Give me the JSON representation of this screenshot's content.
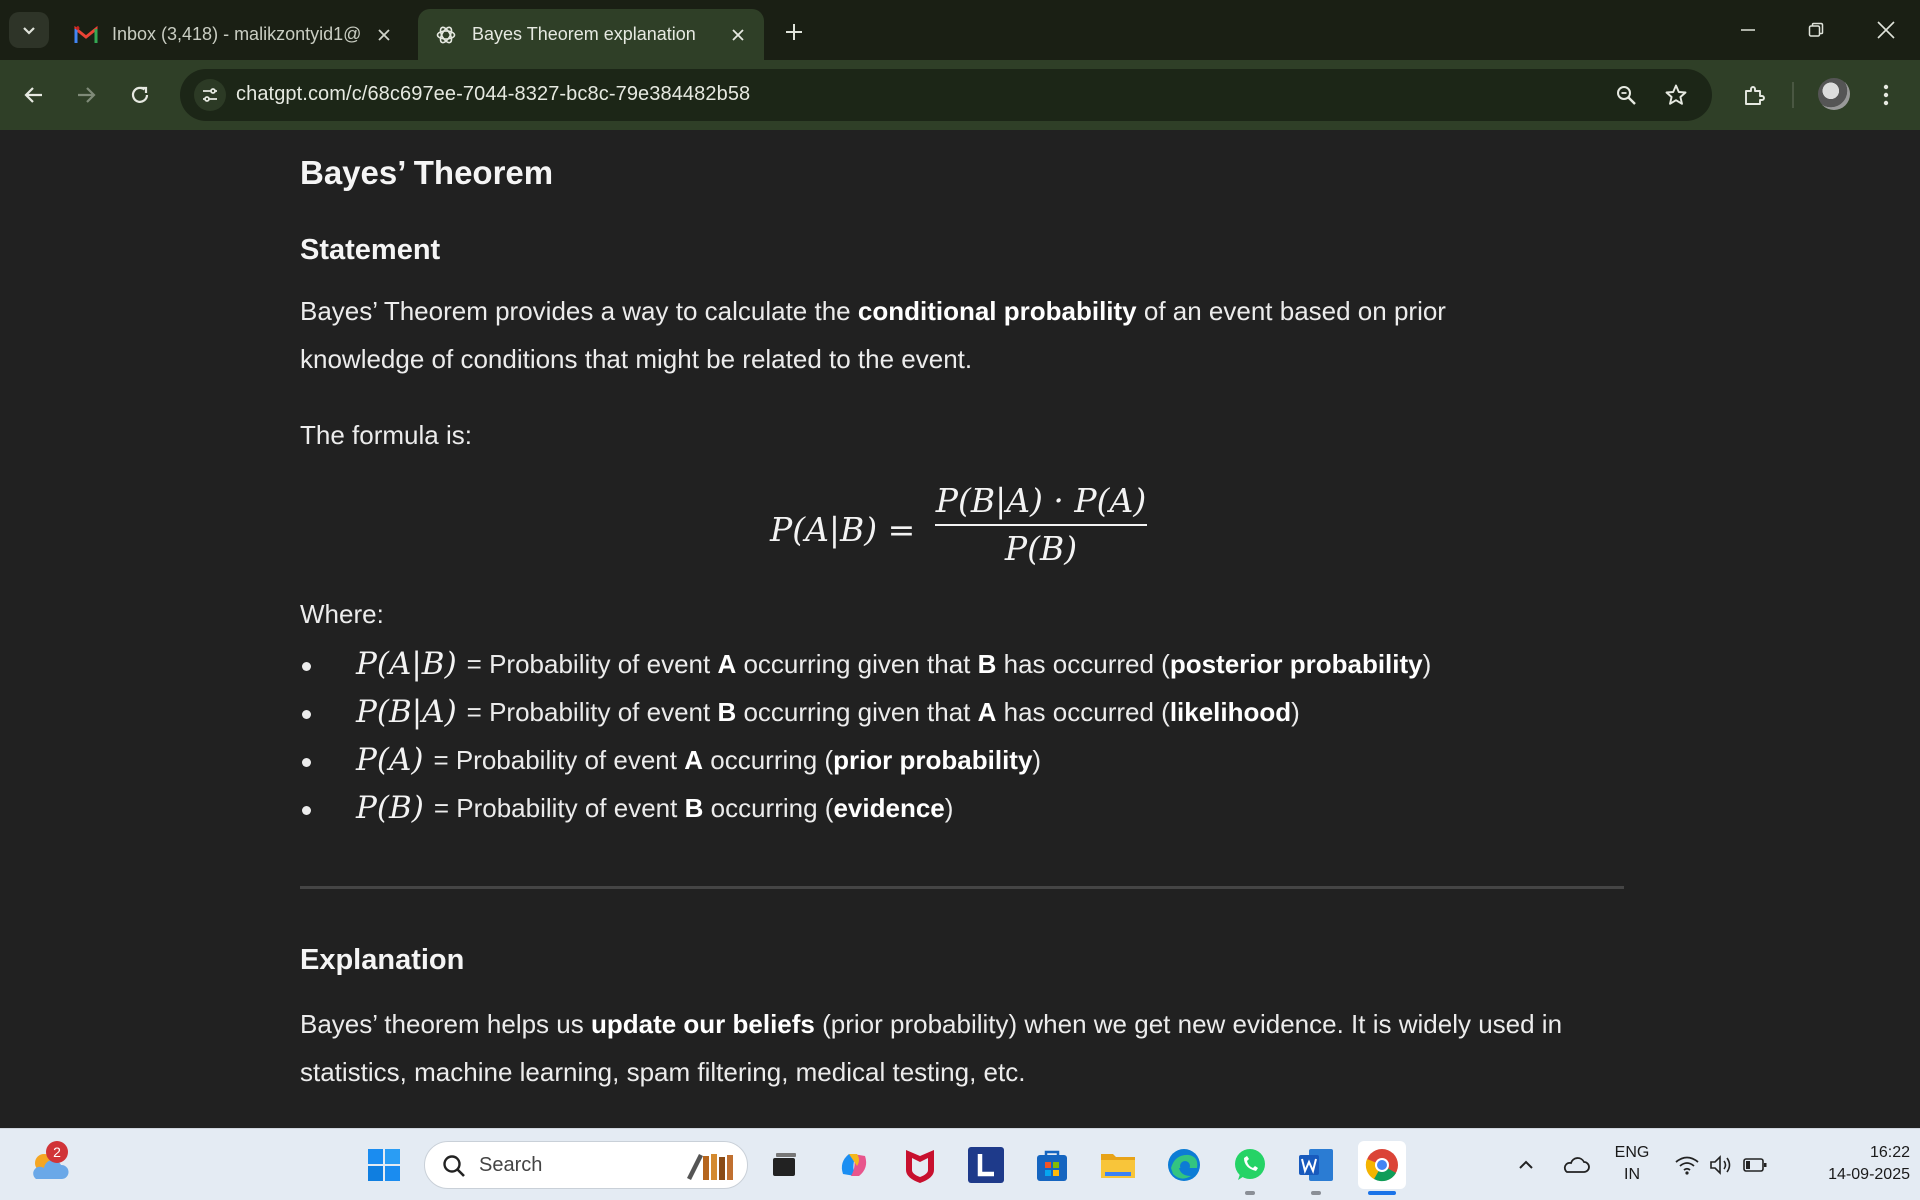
{
  "browser": {
    "tabs": [
      {
        "title": "Inbox (3,418) - malikzontyid1@",
        "favicon": "gmail-icon",
        "active": false
      },
      {
        "title": "Bayes Theorem explanation",
        "favicon": "chatgpt-icon",
        "active": true
      }
    ],
    "url": "chatgpt.com/c/68c697ee-7044-8327-bc8c-79e384482b58"
  },
  "article": {
    "title": "Bayes’ Theorem",
    "statement_heading": "Statement",
    "statement_text": {
      "before": "Bayes’ Theorem provides a way to calculate the ",
      "bold": "conditional probability",
      "after": " of an event based on prior knowledge of conditions that might be related to the event."
    },
    "formula_intro": "The formula is:",
    "formula": {
      "lhs": "P(A|B) =",
      "numerator": "P(B|A) · P(A)",
      "denominator": "P(B)"
    },
    "where_label": "Where:",
    "definitions": [
      {
        "math": "P(A|B)",
        "t1": "= Probability of event ",
        "b1": "A",
        "t2": " occurring given that ",
        "b2": "B",
        "t3": " has occurred (",
        "b3": "posterior probability",
        "t4": ")"
      },
      {
        "math": "P(B|A)",
        "t1": "= Probability of event ",
        "b1": "B",
        "t2": " occurring given that ",
        "b2": "A",
        "t3": " has occurred (",
        "b3": "likelihood",
        "t4": ")"
      },
      {
        "math": "P(A)",
        "t1": "= Probability of event ",
        "b1": "A",
        "t2": " occurring (",
        "b2": "prior probability",
        "t3": ")",
        "b3": "",
        "t4": ""
      },
      {
        "math": "P(B)",
        "t1": "= Probability of event ",
        "b1": "B",
        "t2": " occurring (",
        "b2": "evidence",
        "t3": ")",
        "b3": "",
        "t4": ""
      }
    ],
    "explanation_heading": "Explanation",
    "explanation_text": {
      "before": "Bayes’ theorem helps us ",
      "bold": "update our beliefs",
      "after": " (prior probability) when we get new evidence. It is widely used in statistics, machine learning, spam filtering, medical testing, etc."
    }
  },
  "taskbar": {
    "weather_badge": "2",
    "search_placeholder": "Search",
    "language_line1": "ENG",
    "language_line2": "IN",
    "time": "16:22",
    "date": "14-09-2025",
    "apps": [
      "windows-start-icon",
      "task-view-icon",
      "copilot-icon",
      "mcafee-icon",
      "l-app-icon",
      "microsoft-store-icon",
      "file-explorer-icon",
      "edge-icon",
      "whatsapp-icon",
      "word-icon",
      "chrome-icon"
    ]
  },
  "colors": {
    "page_bg": "#212121",
    "toolbar_bg": "#2f3f27",
    "titlebar_bg": "#1a1f14",
    "taskbar_bg": "#e4ebf3"
  }
}
